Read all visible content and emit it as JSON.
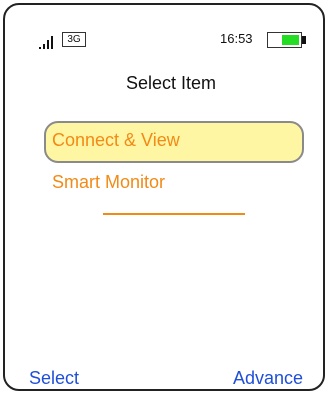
{
  "status_bar": {
    "signal_icon": "signal-strength-icon",
    "network": "3G",
    "time": "16:53",
    "battery_icon": "battery-icon",
    "battery_level": 1.0,
    "colors": {
      "battery_fill": "#22dd22"
    }
  },
  "screen": {
    "title": "Select Item"
  },
  "menu": {
    "items": [
      {
        "label": "Connect & View",
        "selected": true
      },
      {
        "label": "Smart Monitor",
        "selected": false
      }
    ]
  },
  "softkeys": {
    "left_label": "Select",
    "right_label": "Advance"
  },
  "colors": {
    "menu_text": "#f28a16",
    "highlight_fill": "#fff6a3",
    "softkey_text": "#1f4fd8"
  }
}
